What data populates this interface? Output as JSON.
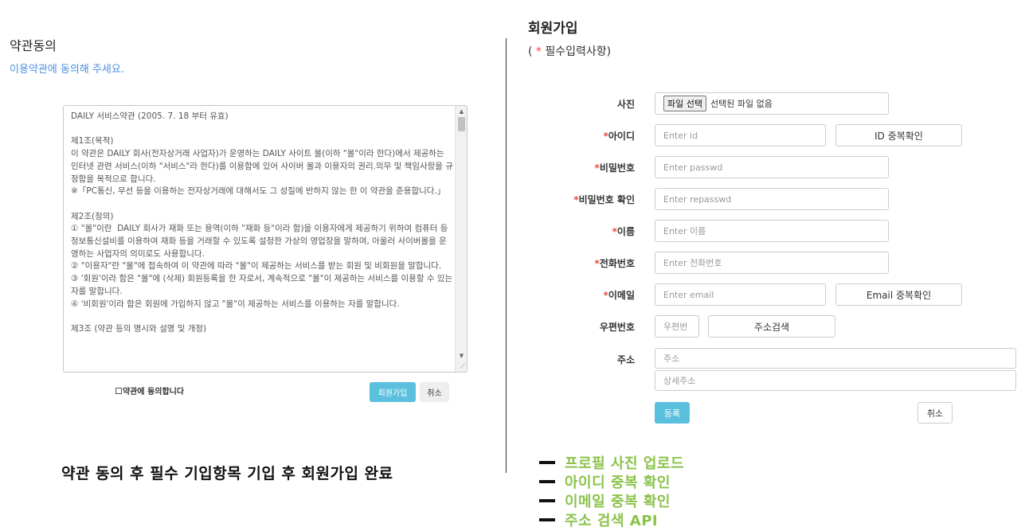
{
  "terms": {
    "title": "약관동의",
    "subtitle": "이용약관에 동의해 주세요.",
    "content": "DAILY 서비스약관 (2005. 7. 18 부터 유효)\n\n제1조(목적)\n이 약관은 DAILY 회사(전자상거래 사업자)가 운영하는 DAILY 사이트 몰(이하 \"몰\"이라 한다)에서 제공하는 인터넷 관련 서비스(이하 \"서비스\"라 한다)를 이용함에 있어 사이버 몰과 이용자의 권리.의무 및 책임사항을 규정함을 목적으로 합니다.\n※「PC통신, 무선 등을 이용하는 전자상거래에 대해서도 그 성질에 반하지 않는 한 이 약관을 준용합니다.」\n\n제2조(정의)\n① \"몰\"이란  DAILY 회사가 재화 또는 용역(이하 \"재화 등\"이라 함)을 이용자에게 제공하기 위하여 컴퓨터 등 정보통신설비를 이용하여 재화 등을 거래할 수 있도록 설정한 가상의 영업장을 말하며, 아울러 사이버몰을 운영하는 사업자의 의미로도 사용합니다.\n② \"이용자\"란 \"몰\"에 접속하여 이 약관에 따라 \"몰\"이 제공하는 서비스를 받는 회원 및 비회원을 말합니다.\n③ '회원'이라 함은 \"몰\"에 (삭제) 회원등록을 한 자로서, 계속적으로 \"몰\"이 제공하는 서비스를 이용할 수 있는 자를 말합니다.\n④ '비회원'이라 함은 회원에 가입하지 않고 \"몰\"이 제공하는 서비스를 이용하는 자를 말합니다.\n\n제3조 (약관 등의 명시와 설명 및 개정)",
    "agree_label": "약관에 동의합니다",
    "join_button": "회원가입",
    "cancel_button": "취소",
    "caption": "약관 동의 후 필수 기입항목 기입 후 회원가입 완료"
  },
  "join": {
    "title": "회원가입",
    "sub_prefix": "( ",
    "sub_star": "*",
    "sub_suffix": " 필수입력사항)",
    "photo_label": "사진",
    "file_button": "파일 선택",
    "file_status": "선택된 파일 없음",
    "id_label": "아이디",
    "id_placeholder": "Enter id",
    "id_check_button": "ID 중복확인",
    "pw_label": "비밀번호",
    "pw_placeholder": "Enter passwd",
    "pw_confirm_label": "비밀번호 확인",
    "pw_confirm_placeholder": "Enter repasswd",
    "name_label": "이름",
    "name_placeholder": "Enter 이름",
    "phone_label": "전화번호",
    "phone_placeholder": "Enter 전화번호",
    "email_label": "이메일",
    "email_placeholder": "Enter email",
    "email_check_button": "Email 중복확인",
    "zip_label": "우편번호",
    "zip_placeholder": "우편번",
    "address_search_button": "주소검색",
    "address_label": "주소",
    "address_placeholder": "주소",
    "address_detail_placeholder": "상세주소",
    "submit_button": "등록",
    "cancel_button": "취소",
    "required_star": "*"
  },
  "features": [
    "프로필 사진 업로드",
    "아이디 중복 확인",
    "이메일 중복 확인",
    "주소 검색 API"
  ]
}
